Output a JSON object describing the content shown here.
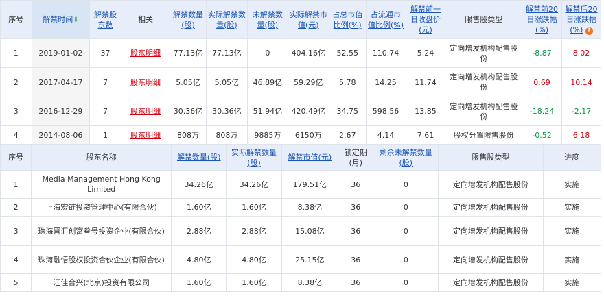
{
  "unlock_table": {
    "headers": {
      "index": "序号",
      "date": "解禁时间",
      "holders": "解禁股东数",
      "related": "相关",
      "qty": "解禁数量(股)",
      "actual_qty": "实际解禁数量(股)",
      "remaining": "未解禁数量(股)",
      "actual_value": "实际解禁市值(元)",
      "pct_total": "占总市值比例(%)",
      "pct_float": "占流通市值比例(%)",
      "prev_close": "解禁前一日收盘价(元)",
      "type": "限售股类型",
      "before20": "解禁前20日涨跌幅(%)",
      "after20": "解禁后20日涨跌幅(%)"
    },
    "help_glyph": "?",
    "sort_glyph": "⬇",
    "rows": [
      {
        "index": "1",
        "date": "2019-01-02",
        "holders": "37",
        "related": "股东明细",
        "qty": "77.13亿",
        "actual_qty": "77.13亿",
        "remaining": "0",
        "actual_value": "404.16亿",
        "pct_total": "52.55",
        "pct_float": "110.74",
        "prev_close": "5.24",
        "type": "定向增发机构配售股份",
        "before20": "-8.87",
        "after20": "8.02"
      },
      {
        "index": "2",
        "date": "2017-04-17",
        "holders": "7",
        "related": "股东明细",
        "qty": "5.05亿",
        "actual_qty": "5.05亿",
        "remaining": "46.89亿",
        "actual_value": "59.29亿",
        "pct_total": "5.78",
        "pct_float": "14.25",
        "prev_close": "11.74",
        "type": "定向增发机构配售股份",
        "before20": "0.69",
        "after20": "10.14"
      },
      {
        "index": "3",
        "date": "2016-12-29",
        "holders": "7",
        "related": "股东明细",
        "qty": "30.36亿",
        "actual_qty": "30.36亿",
        "remaining": "51.94亿",
        "actual_value": "420.49亿",
        "pct_total": "34.75",
        "pct_float": "598.56",
        "prev_close": "13.85",
        "type": "定向增发机构配售股份",
        "before20": "-18.24",
        "after20": "-2.17"
      },
      {
        "index": "4",
        "date": "2014-08-06",
        "holders": "1",
        "related": "股东明细",
        "qty": "808万",
        "actual_qty": "808万",
        "remaining": "9885万",
        "actual_value": "6150万",
        "pct_total": "2.67",
        "pct_float": "4.14",
        "prev_close": "7.61",
        "type": "股权分置限售股份",
        "before20": "-0.52",
        "after20": "6.18"
      }
    ]
  },
  "holder_table": {
    "headers": {
      "index": "序号",
      "name": "股东名称",
      "qty": "解禁数量(股)",
      "actual_qty": "实际解禁数量(股)",
      "value": "解禁市值(元)",
      "lock": "锁定期(月)",
      "remaining": "剩余未解禁数量(股)",
      "type": "限售股类型",
      "progress": "进度"
    },
    "rows": [
      {
        "index": "1",
        "name": "Media Management Hong Kong Limited",
        "qty": "34.26亿",
        "actual_qty": "34.26亿",
        "value": "179.51亿",
        "lock": "36",
        "remaining": "0",
        "type": "定向增发机构配售股份",
        "progress": "实施"
      },
      {
        "index": "2",
        "name": "上海宏链投资管理中心(有限合伙)",
        "qty": "1.60亿",
        "actual_qty": "1.60亿",
        "value": "8.38亿",
        "lock": "36",
        "remaining": "0",
        "type": "定向增发机构配售股份",
        "progress": "实施"
      },
      {
        "index": "3",
        "name": "珠海晋汇创富叁号投资企业(有限合伙)",
        "qty": "2.88亿",
        "actual_qty": "2.88亿",
        "value": "15.08亿",
        "lock": "36",
        "remaining": "0",
        "type": "定向增发机构配售股份",
        "progress": "实施"
      },
      {
        "index": "4",
        "name": "珠海融悟股权投资合伙企业(有限合伙)",
        "qty": "4.80亿",
        "actual_qty": "4.80亿",
        "value": "25.15亿",
        "lock": "36",
        "remaining": "0",
        "type": "定向增发机构配售股份",
        "progress": "实施"
      },
      {
        "index": "5",
        "name": "汇佳合兴(北京)投资有限公司",
        "qty": "1.60亿",
        "actual_qty": "1.60亿",
        "value": "8.38亿",
        "lock": "36",
        "remaining": "0",
        "type": "定向增发机构配售股份",
        "progress": "实施"
      }
    ]
  }
}
